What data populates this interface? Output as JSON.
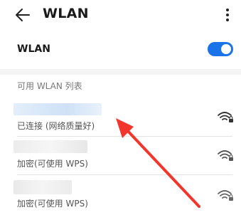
{
  "header": {
    "title": "WLAN",
    "back_icon": "back-arrow-icon",
    "more_icon": "more-vertical-icon"
  },
  "wlan_toggle": {
    "label": "WLAN",
    "on": true,
    "accent": "#1a73e8"
  },
  "available": {
    "header": "可用 WLAN 列表",
    "networks": [
      {
        "status": "已连接 (网络质量好)",
        "icon": "wifi-secured-icon"
      },
      {
        "status": "加密(可使用 WPS)",
        "icon": "wifi-secured-icon"
      },
      {
        "status": "加密(可使用 WPS)",
        "icon": "wifi-secured-icon"
      }
    ]
  },
  "annotation": {
    "color": "#f2362c"
  }
}
